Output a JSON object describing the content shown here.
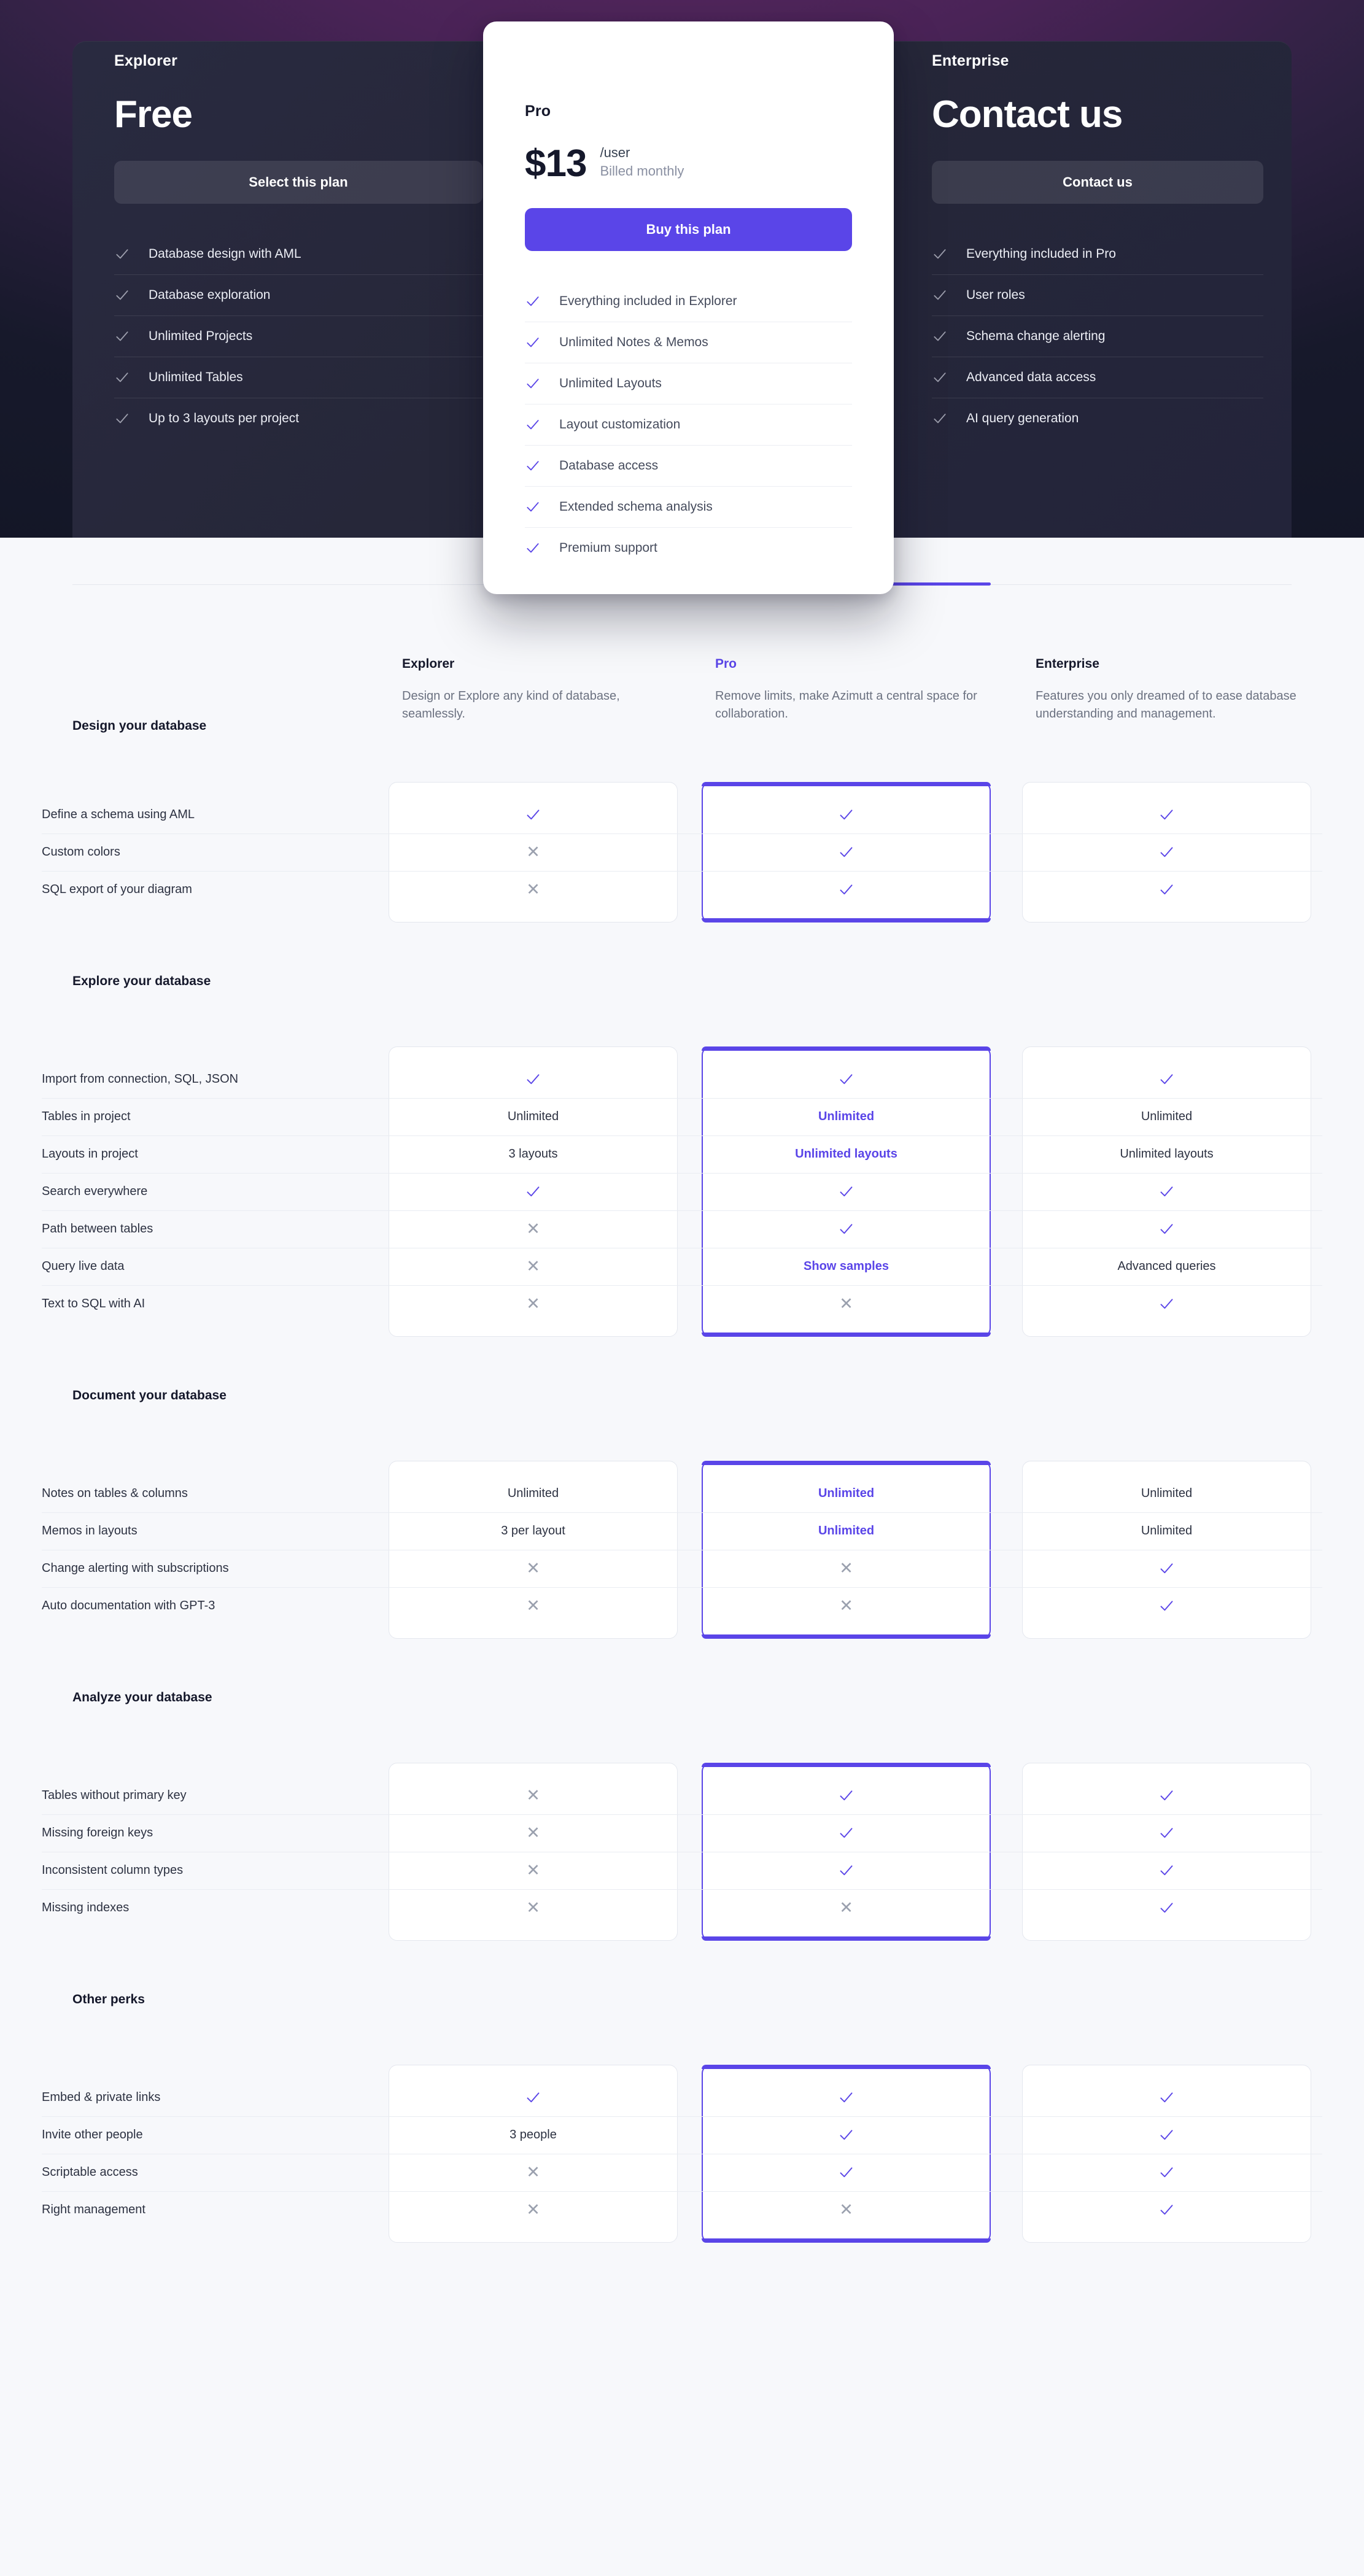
{
  "colors": {
    "accent": "#5a45e8",
    "muted": "#9aa0ae",
    "dark_panel": "#292a40"
  },
  "hero": {
    "explorer": {
      "name": "Explorer",
      "price": "Free",
      "cta": "Select this plan",
      "features": [
        "Database design with AML",
        "Database exploration",
        "Unlimited Projects",
        "Unlimited Tables",
        "Up to 3 layouts per project"
      ]
    },
    "pro": {
      "name": "Pro",
      "price": "$13",
      "per": "/user",
      "billed": "Billed monthly",
      "cta": "Buy this plan",
      "features": [
        "Everything included in Explorer",
        "Unlimited Notes & Memos",
        "Unlimited Layouts",
        "Layout customization",
        "Database access",
        "Extended schema analysis",
        "Premium support"
      ]
    },
    "enterprise": {
      "name": "Enterprise",
      "price": "Contact us",
      "cta": "Contact us",
      "features": [
        "Everything included in Pro",
        "User roles",
        "Schema change alerting",
        "Advanced data access",
        "AI query generation"
      ]
    }
  },
  "compare": {
    "plans": [
      {
        "name": "Explorer",
        "desc": "Design or Explore any kind of database, seamlessly."
      },
      {
        "name": "Pro",
        "desc": "Remove limits, make Azimutt a central space for collaboration."
      },
      {
        "name": "Enterprise",
        "desc": "Features you only dreamed of to ease database understanding and management."
      }
    ],
    "sections": [
      {
        "title": "Design your database",
        "rows": [
          {
            "label": "Define a schema using AML",
            "explorer": "check",
            "pro": "check",
            "enterprise": "check"
          },
          {
            "label": "Custom colors",
            "explorer": "cross",
            "pro": "check",
            "enterprise": "check"
          },
          {
            "label": "SQL export of your diagram",
            "explorer": "cross",
            "pro": "check",
            "enterprise": "check"
          }
        ]
      },
      {
        "title": "Explore your database",
        "rows": [
          {
            "label": "Import from connection, SQL, JSON",
            "explorer": "check",
            "pro": "check",
            "enterprise": "check"
          },
          {
            "label": "Tables in project",
            "explorer": "Unlimited",
            "pro": "Unlimited",
            "enterprise": "Unlimited"
          },
          {
            "label": "Layouts in project",
            "explorer": "3 layouts",
            "pro": "Unlimited layouts",
            "enterprise": "Unlimited layouts"
          },
          {
            "label": "Search everywhere",
            "explorer": "check",
            "pro": "check",
            "enterprise": "check"
          },
          {
            "label": "Path between tables",
            "explorer": "cross",
            "pro": "check",
            "enterprise": "check"
          },
          {
            "label": "Query live data",
            "explorer": "cross",
            "pro": "Show samples",
            "enterprise": "Advanced queries"
          },
          {
            "label": "Text to SQL with AI",
            "explorer": "cross",
            "pro": "cross",
            "enterprise": "check"
          }
        ]
      },
      {
        "title": "Document your database",
        "rows": [
          {
            "label": "Notes on tables & columns",
            "explorer": "Unlimited",
            "pro": "Unlimited",
            "enterprise": "Unlimited"
          },
          {
            "label": "Memos in layouts",
            "explorer": "3 per layout",
            "pro": "Unlimited",
            "enterprise": "Unlimited"
          },
          {
            "label": "Change alerting with subscriptions",
            "explorer": "cross",
            "pro": "cross",
            "enterprise": "check"
          },
          {
            "label": "Auto documentation with GPT-3",
            "explorer": "cross",
            "pro": "cross",
            "enterprise": "check"
          }
        ]
      },
      {
        "title": "Analyze your database",
        "rows": [
          {
            "label": "Tables without primary key",
            "explorer": "cross",
            "pro": "check",
            "enterprise": "check"
          },
          {
            "label": "Missing foreign keys",
            "explorer": "cross",
            "pro": "check",
            "enterprise": "check"
          },
          {
            "label": "Inconsistent column types",
            "explorer": "cross",
            "pro": "check",
            "enterprise": "check"
          },
          {
            "label": "Missing indexes",
            "explorer": "cross",
            "pro": "cross",
            "enterprise": "check"
          }
        ]
      },
      {
        "title": "Other perks",
        "rows": [
          {
            "label": "Embed & private links",
            "explorer": "check",
            "pro": "check",
            "enterprise": "check"
          },
          {
            "label": "Invite other people",
            "explorer": "3 people",
            "pro": "check",
            "enterprise": "check"
          },
          {
            "label": "Scriptable access",
            "explorer": "cross",
            "pro": "check",
            "enterprise": "check"
          },
          {
            "label": "Right management",
            "explorer": "cross",
            "pro": "cross",
            "enterprise": "check"
          }
        ]
      }
    ]
  }
}
